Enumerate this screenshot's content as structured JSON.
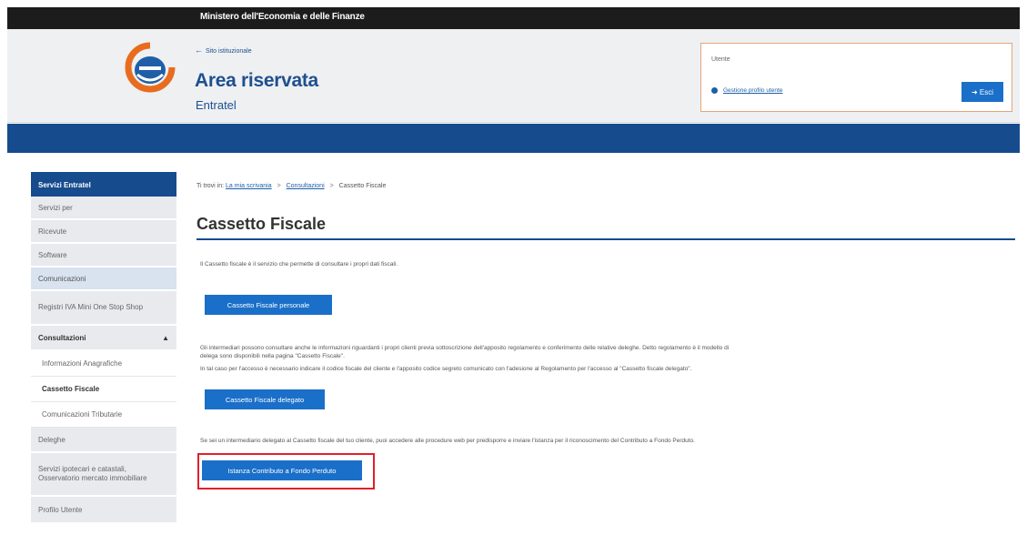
{
  "topbar": {
    "ministry": "Ministero dell'Economia e delle Finanze"
  },
  "header": {
    "back_link": "Sito istituzionale",
    "title": "Area riservata",
    "subtitle": "Entratel"
  },
  "login": {
    "label": "Utente",
    "link_text": "Gestione profilo utente",
    "exit_button": "Esci"
  },
  "sidebar": {
    "heading": "Servizi Entratel",
    "items": [
      {
        "label": "Servizi per"
      },
      {
        "label": "Ricevute"
      },
      {
        "label": "Software"
      },
      {
        "label": "Comunicazioni"
      },
      {
        "label": "Registri IVA Mini One Stop Shop"
      }
    ],
    "section": {
      "label": "Consultazioni"
    },
    "subitems": [
      {
        "label": "Informazioni Anagrafiche"
      },
      {
        "label": "Cassetto Fiscale"
      },
      {
        "label": "Comunicazioni Tributarie"
      }
    ],
    "items_after": [
      {
        "label": "Deleghe"
      },
      {
        "label": "Servizi ipotecari e catastali, Osservatorio mercato immobiliare"
      },
      {
        "label": "Profilo Utente"
      }
    ]
  },
  "breadcrumb": {
    "prefix": "Ti trovi in:",
    "crumbs": [
      "La mia scrivania",
      "Consultazioni"
    ],
    "current": "Cassetto Fiscale"
  },
  "main": {
    "title": "Cassetto Fiscale",
    "intro": "Il Cassetto fiscale è il servizio che permette di consultare i propri dati fiscali.",
    "btn_personal": "Cassetto Fiscale personale",
    "delegate_text_1": "Gli intermediari possono consultare anche le informazioni riguardanti i propri clienti previa sottoscrizione dell'apposito regolamento e conferimento delle relative deleghe. Detto regolamento è il modello di",
    "delegate_text_2": "delega sono disponibili nella pagina \"Cassetto Fiscale\".",
    "delegate_text_3": "In tal caso per l'accesso è necessario indicare il codice fiscale del cliente e l'apposito codice segreto comunicato con l'adesione al Regolamento per l'accesso al \"Cassetto fiscale delegato\".",
    "btn_delegated": "Cassetto Fiscale delegato",
    "grant_text": "Se sei un intermediario delegato al Cassetto fiscale del tuo cliente, puoi accedere alle procedure web per predisporre e inviare l'istanza per il riconoscimento del Contributo a Fondo Perduto.",
    "btn_grant": "Istanza Contributo a Fondo Perduto"
  },
  "colors": {
    "primary_blue": "#164b8e",
    "button_blue": "#1a6fc9",
    "highlight_red": "#e0202a"
  }
}
